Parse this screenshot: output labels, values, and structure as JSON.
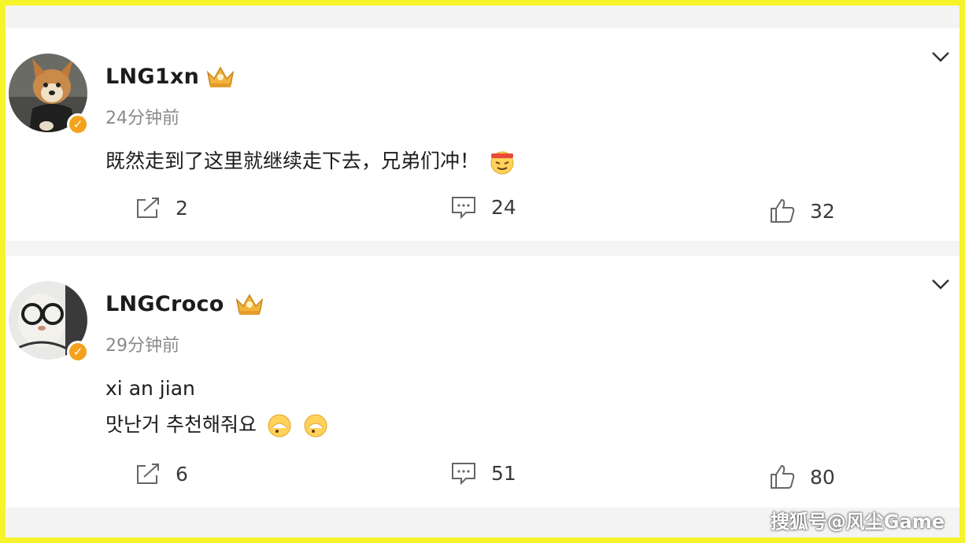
{
  "comments": [
    {
      "username": "LNG1xn",
      "time": "24分钟前",
      "text_lines": [
        "既然走到了这里就继续走下去，兄弟们冲！"
      ],
      "reposts": "2",
      "replies": "24",
      "likes": "32"
    },
    {
      "username": "LNGCroco",
      "time": "29分钟前",
      "text_lines": [
        "xi an jian",
        "맛난거 추천해줘요"
      ],
      "reposts": "6",
      "replies": "51",
      "likes": "80"
    }
  ],
  "icons": {
    "repost": "repost-icon",
    "comment": "comment-icon",
    "like": "thumbs-up-icon",
    "more": "chevron-down-icon",
    "verified": "verified-badge-icon",
    "crown": "crown-badge-icon"
  },
  "colors": {
    "border": "#f7f32a",
    "verified": "#f3a21e",
    "crown": "#f2b33d"
  },
  "watermark": "搜狐号@风尘Game"
}
